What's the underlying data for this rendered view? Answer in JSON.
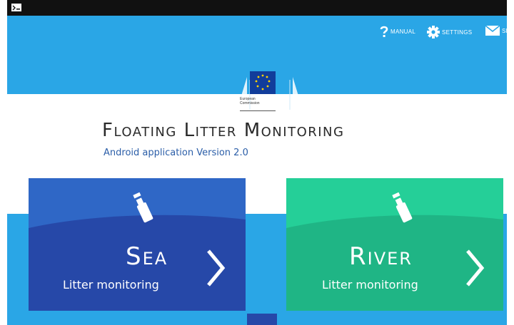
{
  "app_bar": {
    "actions": [
      {
        "label": "MANUAL",
        "icon": "question-mark-icon"
      },
      {
        "label": "SETTINGS",
        "icon": "gear-icon"
      },
      {
        "label": "SEN",
        "icon": "envelope-icon"
      }
    ]
  },
  "logo": {
    "line1": "European",
    "line2": "Commission"
  },
  "header": {
    "title": "Floating Litter Monitoring",
    "subtitle": "Android application Version 2.0"
  },
  "tiles": {
    "sea": {
      "title": "Sea",
      "subtitle": "Litter monitoring",
      "color": "#2648a8"
    },
    "river": {
      "title": "River",
      "subtitle": "Litter monitoring",
      "color": "#1fb585"
    }
  },
  "colors": {
    "accent": "#2aa6e6",
    "status_bar": "#111111"
  }
}
